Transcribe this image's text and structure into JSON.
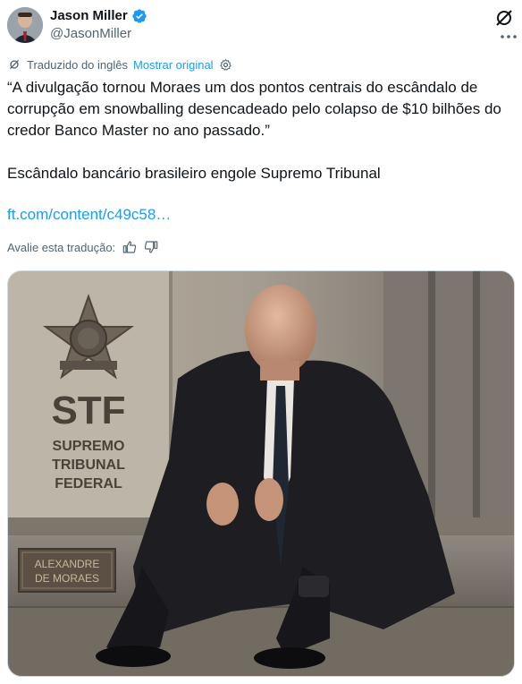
{
  "author": {
    "name": "Jason Miller",
    "handle": "@JasonMiller",
    "verified": true
  },
  "translation": {
    "label": "Traduzido do inglês",
    "show_original": "Mostrar original"
  },
  "tweet": {
    "text": "“A divulgação tornou Moraes um dos pontos centrais do escândalo de corrupção em snowballing desencadeado pelo colapso de $10 bilhões do credor Banco Master no ano passado.”\n\nEscândalo bancário brasileiro engole Supremo Tribunal",
    "link": "ft.com/content/c49c58…"
  },
  "rating": {
    "prompt": "Avalie esta tradução:"
  },
  "image": {
    "sign_abbr": "STF",
    "sign_line1": "SUPREMO",
    "sign_line2": "TRIBUNAL",
    "sign_line3": "FEDERAL",
    "plaque_line1": "ALEXANDRE",
    "plaque_line2": "DE MORAES"
  },
  "colors": {
    "accent": "#1d9bf0",
    "secondary_text": "#536471",
    "text": "#0f1419"
  },
  "icons": {
    "verified": "verified-badge-icon",
    "grok": "grok-icon",
    "translate": "translate-icon",
    "settings": "gear-icon",
    "thumbs_up": "thumbs-up-icon",
    "thumbs_down": "thumbs-down-icon"
  }
}
